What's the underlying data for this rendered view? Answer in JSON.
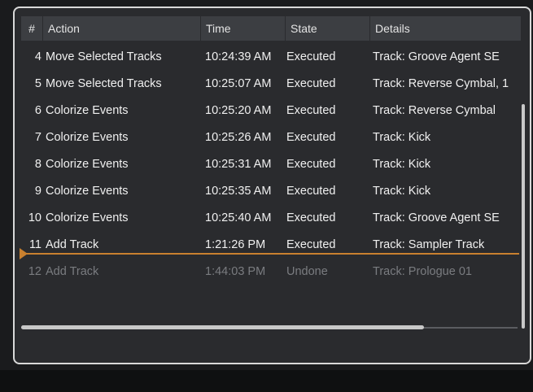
{
  "header": {
    "num": "#",
    "action": "Action",
    "time": "Time",
    "state": "State",
    "details": "Details"
  },
  "rows": [
    {
      "num": "4",
      "action": "Move Selected Tracks",
      "time": "10:24:39 AM",
      "state": "Executed",
      "details": "Track: Groove Agent SE"
    },
    {
      "num": "5",
      "action": "Move Selected Tracks",
      "time": "10:25:07 AM",
      "state": "Executed",
      "details": "Track: Reverse Cymbal, 1"
    },
    {
      "num": "6",
      "action": "Colorize Events",
      "time": "10:25:20 AM",
      "state": "Executed",
      "details": "Track: Reverse Cymbal"
    },
    {
      "num": "7",
      "action": "Colorize Events",
      "time": "10:25:26 AM",
      "state": "Executed",
      "details": "Track: Kick"
    },
    {
      "num": "8",
      "action": "Colorize Events",
      "time": "10:25:31 AM",
      "state": "Executed",
      "details": "Track: Kick"
    },
    {
      "num": "9",
      "action": "Colorize Events",
      "time": "10:25:35 AM",
      "state": "Executed",
      "details": "Track: Kick"
    },
    {
      "num": "10",
      "action": "Colorize Events",
      "time": "10:25:40 AM",
      "state": "Executed",
      "details": "Track: Groove Agent SE"
    },
    {
      "num": "11",
      "action": "Add Track",
      "time": "1:21:26 PM",
      "state": "Executed",
      "details": "Track: Sampler Track"
    },
    {
      "num": "12",
      "action": "Add Track",
      "time": "1:44:03 PM",
      "state": "Undone",
      "details": "Track: Prologue 01"
    }
  ],
  "colors": {
    "undo_marker": "#c9802f",
    "executed_text": "#f0f0f0",
    "undone_text": "#7a7c80"
  }
}
